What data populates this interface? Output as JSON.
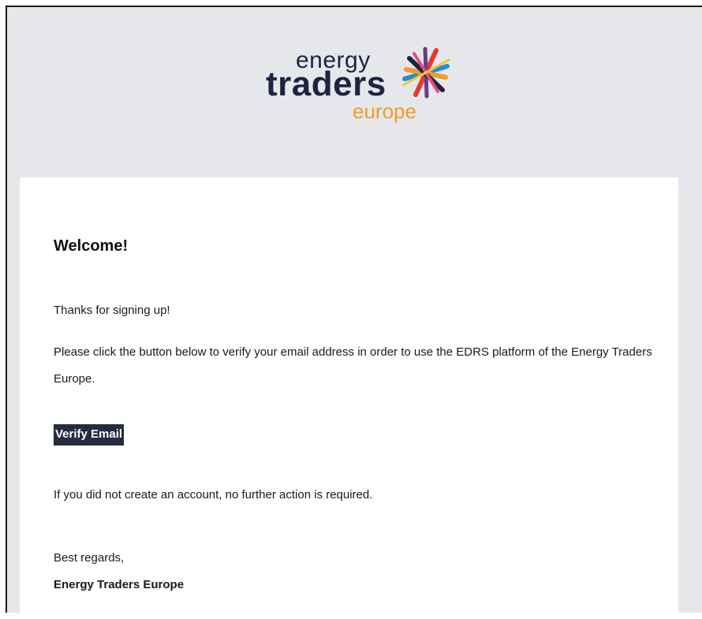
{
  "header": {
    "logo": {
      "line1": "energy",
      "line2": "traders",
      "line3": "europe",
      "colors": {
        "text": "#1f2340",
        "accent": "#f29a2e",
        "burst": [
          "#e23b2e",
          "#f29a2e",
          "#1f8fd6",
          "#6a3b8f",
          "#1f2340",
          "#e84a7c"
        ]
      }
    }
  },
  "email": {
    "heading": "Welcome!",
    "greeting": "Thanks for signing up!",
    "instruction": "Please click the button below to verify your email address in order to use the EDRS platform of the Energy Traders Europe.",
    "verify_button": "Verify Email",
    "disclaimer": "If you did not create an account, no further action is required.",
    "signoff": "Best regards,",
    "signature": "Energy Traders Europe"
  },
  "colors": {
    "background": "#e6e7eb",
    "card": "#ffffff",
    "button_bg": "#262c40",
    "button_text": "#ffffff"
  }
}
